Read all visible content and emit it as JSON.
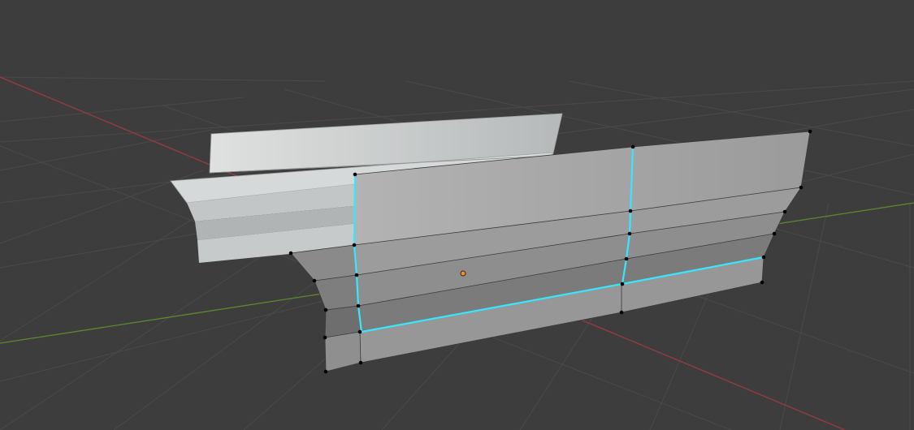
{
  "viewport": {
    "background": "#3d3d3d",
    "grid_color": "#4b4b4b",
    "x_axis_color": "#a0393f",
    "y_axis_color": "#5f8c2e",
    "mesh_face_color": "#9a9a9a",
    "back_mesh_color": "#c7cbcb",
    "selected_edge_color": "#33e5ff",
    "vertex_color": "#000000",
    "origin_color": "#ff8c1a"
  }
}
